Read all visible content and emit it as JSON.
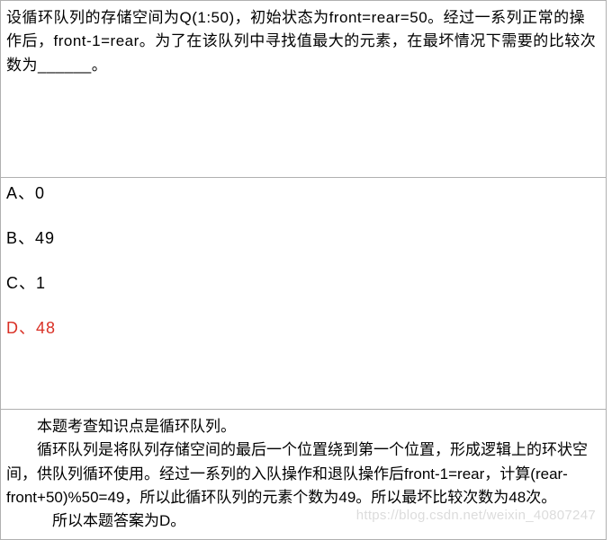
{
  "question": {
    "text": "设循环队列的存储空间为Q(1:50)，初始状态为front=rear=50。经过一系列正常的操作后，front-1=rear。为了在该队列中寻找值最大的元素，在最坏情况下需要的比较次数为______。"
  },
  "options": {
    "a": "A、0",
    "b": "B、49",
    "c": "C、1",
    "d": "D、48"
  },
  "explanation": {
    "line1": "本题考查知识点是循环队列。",
    "line2": "循环队列是将队列存储空间的最后一个位置绕到第一个位置，形成逻辑上的环状空间，供队列循环使用。经过一系列的入队操作和退队操作后front-1=rear，计算(rear-front+50)%50=49，所以此循环队列的元素个数为49。所以最坏比较次数为48次。",
    "line3": "所以本题答案为D。"
  },
  "watermark": "https://blog.csdn.net/weixin_40807247"
}
